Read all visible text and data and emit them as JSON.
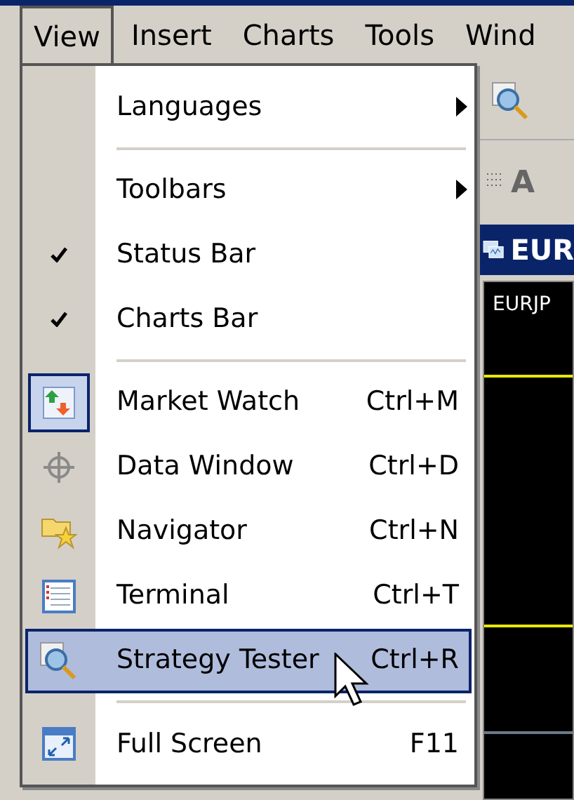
{
  "menu_bar": [
    {
      "label": "View",
      "selected": true
    },
    {
      "label": "Insert",
      "selected": false
    },
    {
      "label": "Charts",
      "selected": false
    },
    {
      "label": "Tools",
      "selected": false
    },
    {
      "label": "Wind",
      "selected": false
    }
  ],
  "view_menu": [
    {
      "kind": "submenu",
      "label": "Languages",
      "selected": false
    },
    {
      "kind": "separator"
    },
    {
      "kind": "submenu",
      "label": "Toolbars",
      "selected": false
    },
    {
      "kind": "check",
      "label": "Status Bar",
      "checked": true,
      "selected": false
    },
    {
      "kind": "check",
      "label": "Charts Bar",
      "checked": true,
      "selected": false
    },
    {
      "kind": "separator"
    },
    {
      "kind": "icon",
      "label": "Market Watch",
      "shortcut": "Ctrl+M",
      "checked": true,
      "selected": false
    },
    {
      "kind": "icon",
      "label": "Data Window",
      "shortcut": "Ctrl+D",
      "checked": false,
      "selected": false
    },
    {
      "kind": "icon",
      "label": "Navigator",
      "shortcut": "Ctrl+N",
      "checked": false,
      "selected": false
    },
    {
      "kind": "icon",
      "label": "Terminal",
      "shortcut": "Ctrl+T",
      "checked": false,
      "selected": false
    },
    {
      "kind": "icon",
      "label": "Strategy Tester",
      "shortcut": "Ctrl+R",
      "checked": false,
      "selected": true
    },
    {
      "kind": "separator"
    },
    {
      "kind": "icon",
      "label": "Full Screen",
      "shortcut": "F11",
      "checked": false,
      "selected": false
    }
  ],
  "toolbar": {
    "font_button": "A"
  },
  "chart_window": {
    "title": "EUR",
    "symbol": "EURJP"
  }
}
